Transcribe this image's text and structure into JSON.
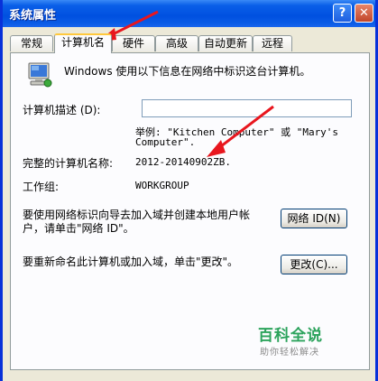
{
  "window": {
    "title": "系统属性",
    "help_label": "?",
    "close_label": "✕"
  },
  "tabs": [
    {
      "label": "常规",
      "active": false
    },
    {
      "label": "计算机名",
      "active": true
    },
    {
      "label": "硬件",
      "active": false
    },
    {
      "label": "高级",
      "active": false
    },
    {
      "label": "自动更新",
      "active": false
    },
    {
      "label": "远程",
      "active": false
    }
  ],
  "panel": {
    "intro": "Windows 使用以下信息在网络中标识这台计算机。",
    "description_label": "计算机描述 (D):",
    "description_value": "",
    "example_line1": "举例: \"Kitchen Computer\" 或 \"Mary's",
    "example_line2": "Computer\".",
    "fullname_label": "完整的计算机名称:",
    "fullname_value": "2012-20140902ZB.",
    "workgroup_label": "工作组:",
    "workgroup_value": "WORKGROUP",
    "netid_text_line1": "要使用网络标识向导去加入域并创建本地用户帐",
    "netid_text_line2": "户，请单击\"网络 ID\"。",
    "netid_button": "网络 ID(N)",
    "rename_text": "要重新命名此计算机或加入域，单击\"更改\"。",
    "change_button": "更改(C)..."
  },
  "watermark": {
    "main": "百科全说",
    "sub": "助你轻松解决"
  },
  "colors": {
    "titlebar": "#0A5FE8",
    "annotation_arrow": "#E8161E",
    "watermark_green": "#2CA35C"
  }
}
